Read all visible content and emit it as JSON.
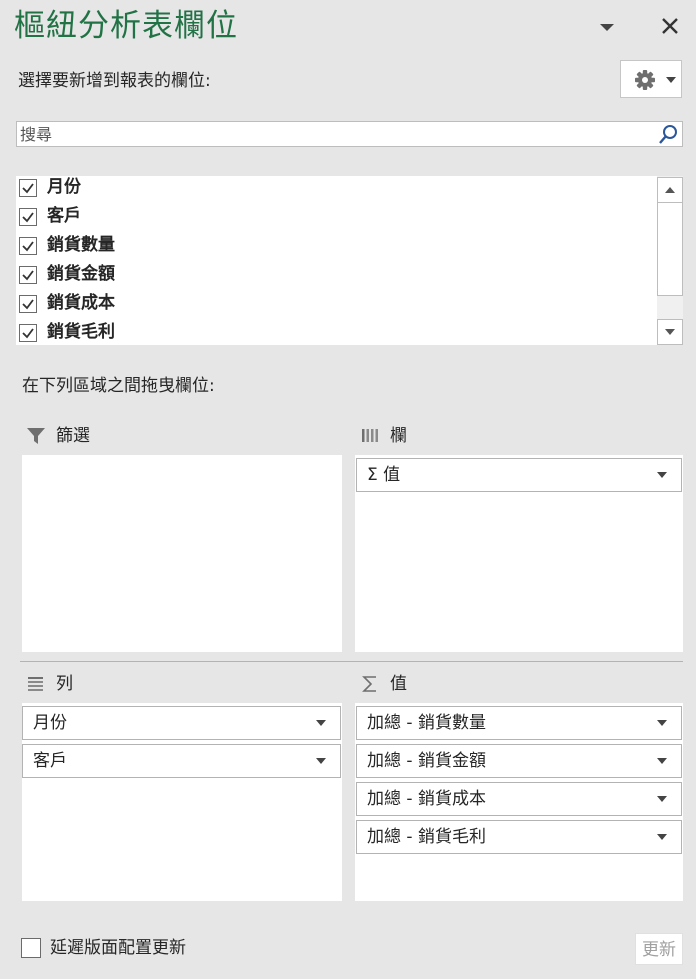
{
  "pane": {
    "title": "樞紐分析表欄位"
  },
  "choose_fields_label": "選擇要新增到報表的欄位:",
  "search": {
    "placeholder": "搜尋",
    "value": ""
  },
  "fields": [
    {
      "label": "月份",
      "checked": true
    },
    {
      "label": "客戶",
      "checked": true
    },
    {
      "label": "銷貨數量",
      "checked": true
    },
    {
      "label": "銷貨金額",
      "checked": true
    },
    {
      "label": "銷貨成本",
      "checked": true
    },
    {
      "label": "銷貨毛利",
      "checked": true
    }
  ],
  "drag_label": "在下列區域之間拖曳欄位:",
  "areas": {
    "filters": {
      "label": "篩選"
    },
    "columns": {
      "label": "欄",
      "items": [
        "Σ 值"
      ]
    },
    "rows": {
      "label": "列",
      "items": [
        "月份",
        "客戶"
      ]
    },
    "values": {
      "label": "值",
      "items": [
        "加總 - 銷貨數量",
        "加總 - 銷貨金額",
        "加總 - 銷貨成本",
        "加總 - 銷貨毛利"
      ]
    }
  },
  "footer": {
    "defer_label": "延遲版面配置更新",
    "update_label": "更新",
    "defer_checked": false
  },
  "colors": {
    "title": "#217346",
    "background": "#e6e6e6"
  },
  "icons": [
    "dropdown-icon",
    "close-icon",
    "gear-icon",
    "search-icon",
    "filter-icon",
    "columns-icon",
    "rows-icon",
    "sigma-icon",
    "chevron-up-icon",
    "chevron-down-icon"
  ]
}
